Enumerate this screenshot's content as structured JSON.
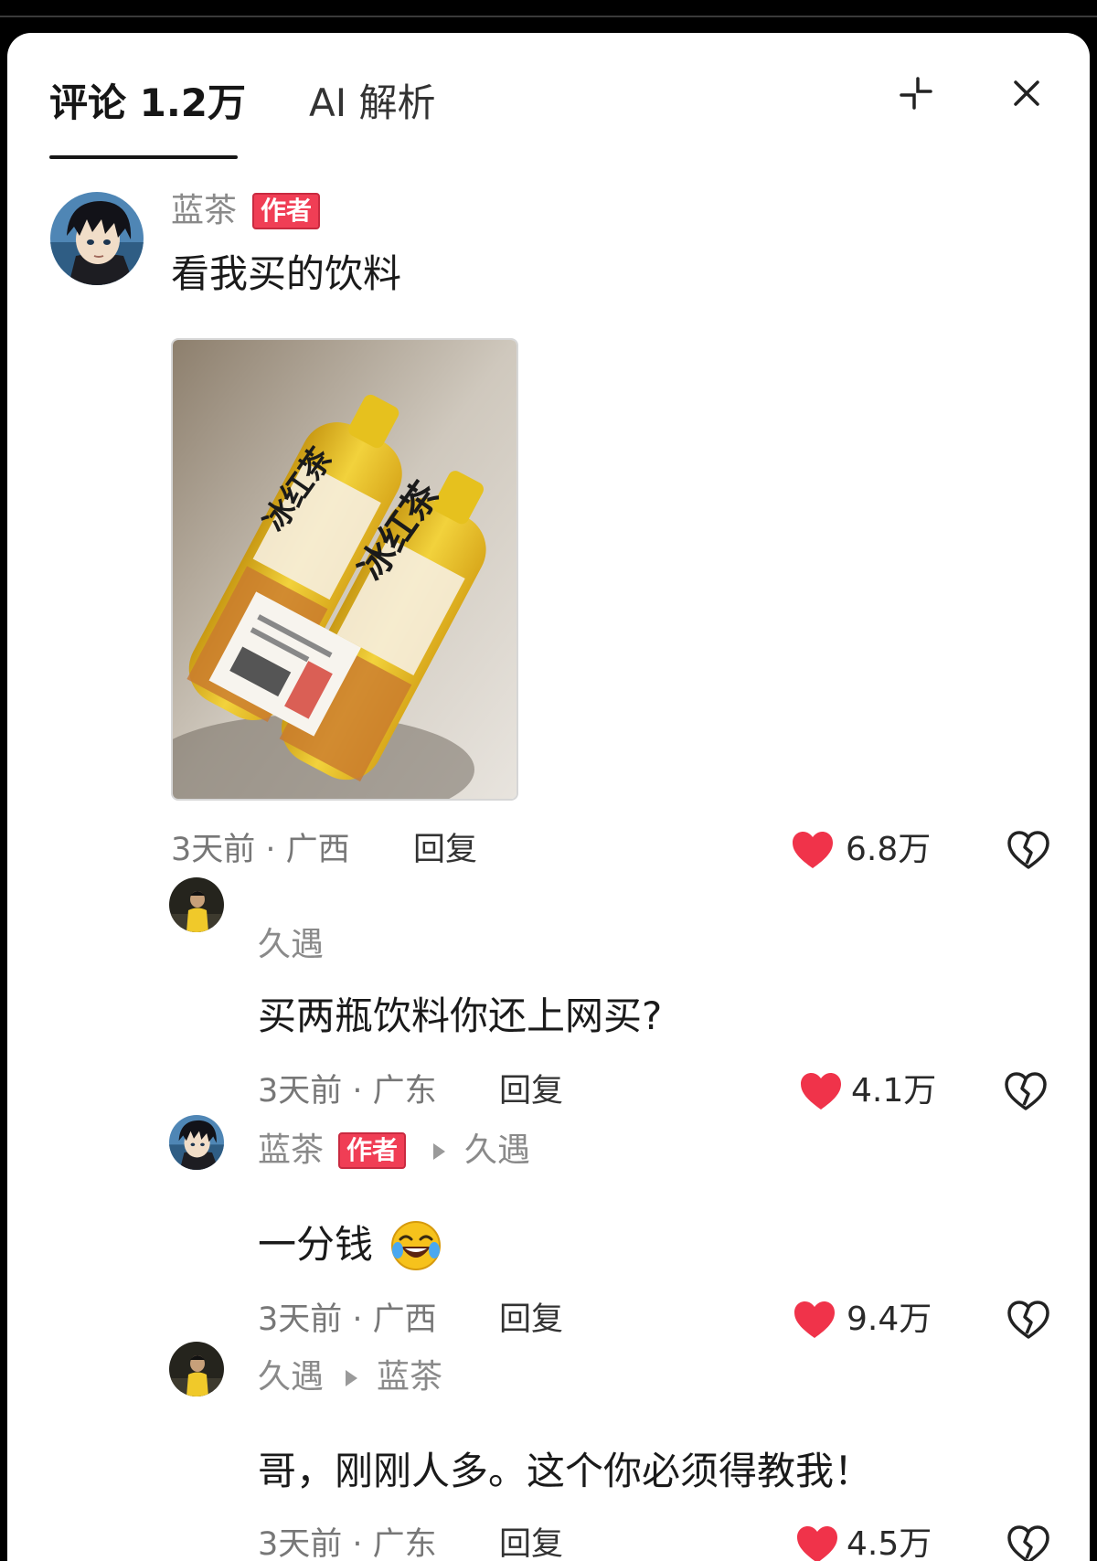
{
  "tabs": {
    "comments": "评论 1.2万",
    "ai": "AI 解析"
  },
  "comments": [
    {
      "name": "蓝茶",
      "badge": "作者",
      "text": "看我买的饮料",
      "meta": "3天前 · 广西",
      "reply": "回复",
      "likes": "6.8万"
    },
    {
      "name": "久遇",
      "text": "买两瓶饮料你还上网买?",
      "meta": "3天前 · 广东",
      "reply": "回复",
      "likes": "4.1万"
    },
    {
      "name": "蓝茶",
      "badge": "作者",
      "reply_to": "久遇",
      "text": "一分钱",
      "meta": "3天前 · 广西",
      "reply": "回复",
      "likes": "9.4万"
    },
    {
      "name": "久遇",
      "reply_to": "蓝茶",
      "text": "哥，刚刚人多。这个你必须得教我！",
      "meta": "3天前 · 广东",
      "reply": "回复",
      "likes": "4.5万"
    }
  ],
  "photo": {
    "bottle_label": "冰红茶"
  },
  "colors": {
    "accent": "#f03e55",
    "like": "#f0334a",
    "text_muted": "#8a8a8a"
  }
}
